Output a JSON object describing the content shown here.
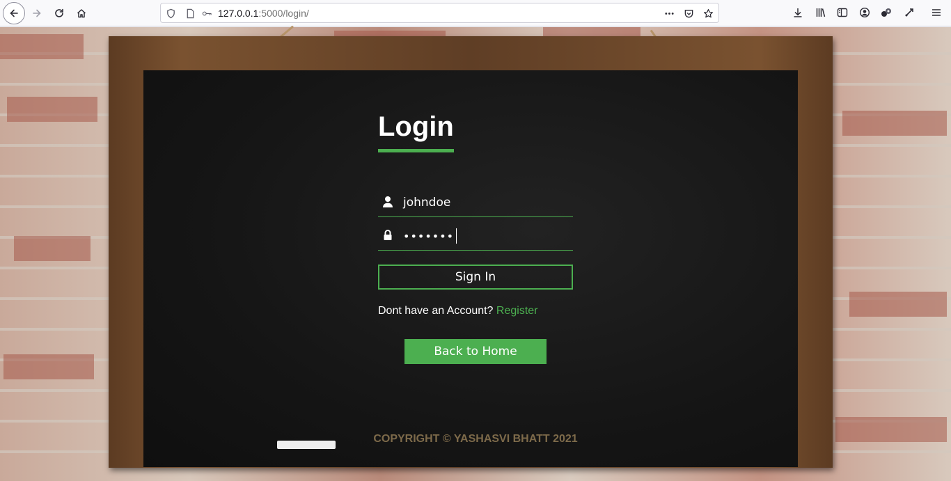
{
  "browser": {
    "url_host": "127.0.0.1",
    "url_path": ":5000/login/",
    "icons": {
      "back": "back-arrow-icon",
      "forward": "forward-arrow-icon",
      "reload": "reload-icon",
      "home": "home-icon",
      "shield": "shield-icon",
      "page": "page-icon",
      "key": "key-icon",
      "more": "more-icon",
      "pocket": "pocket-icon",
      "bookmark": "bookmark-star-icon",
      "downloads": "download-icon",
      "library": "library-icon",
      "sidebar": "sidebar-icon",
      "account": "account-icon",
      "extensions": "extensions-icon",
      "menu": "menu-icon"
    }
  },
  "login": {
    "title": "Login",
    "username_value": "johndoe",
    "password_mask": "•••••••",
    "signin_label": "Sign In",
    "account_prompt": "Dont have an Account?",
    "register_label": "Register",
    "back_home_label": "Back to Home",
    "copyright": "COPYRIGHT © YASHASVI BHATT 2021",
    "accent_color": "#4caf50"
  }
}
